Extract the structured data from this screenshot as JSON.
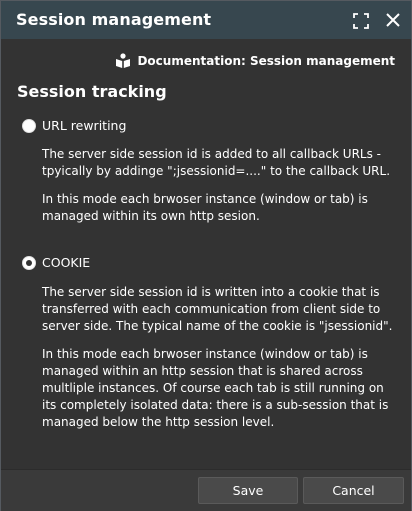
{
  "dialog": {
    "title": "Session management",
    "maximize_icon": "maximize-icon",
    "close_icon": "close-icon"
  },
  "documentation": {
    "icon": "book-user-icon",
    "label": "Documentation: Session management"
  },
  "section": {
    "title": "Session tracking"
  },
  "options": [
    {
      "label": "URL rewriting",
      "selected": false,
      "paragraphs": [
        "The server side session id is added to all callback URLs - tpyically by addinge \";jsessionid=....\" to the callback URL.",
        "In this mode each brwoser instance (window or tab) is managed within its own http sesion."
      ]
    },
    {
      "label": "COOKIE",
      "selected": true,
      "paragraphs": [
        "The server side session id is written into a cookie that is transferred with each communication from client side to server side. The typical name of the cookie is \"jsessionid\".",
        "In this mode each brwoser instance (window or tab) is managed within an http session that is shared across multliple instances. Of course each tab is still running on its completely isolated data: there is a sub-session that is managed below the http session level."
      ]
    }
  ],
  "footer": {
    "save_label": "Save",
    "cancel_label": "Cancel"
  },
  "colors": {
    "titlebar": "#37474f",
    "background": "#333333",
    "footer": "#3a3a3a",
    "button": "#4a4a4a",
    "text": "#ffffff"
  }
}
